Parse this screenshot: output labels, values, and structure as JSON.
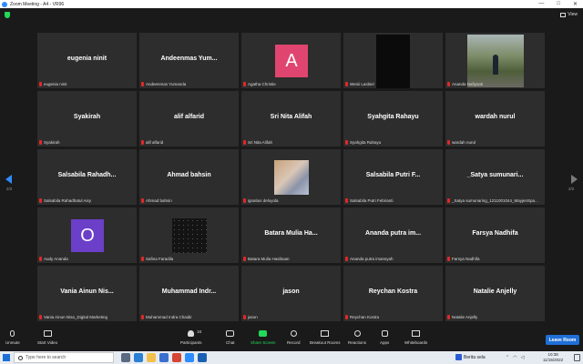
{
  "window": {
    "title": "Zoom Meeting - A4 - VR96",
    "controls": [
      "—",
      "□",
      "✕"
    ]
  },
  "view": {
    "label": "View"
  },
  "participants": [
    {
      "name": "eugenia ninit",
      "footer": "eugenia ninit",
      "media": "none"
    },
    {
      "name": "Andeenmas  Yum...",
      "footer": "Andeenmas Yumanda",
      "media": "none"
    },
    {
      "name": "",
      "footer": "Agatha Christie",
      "media": "avatar",
      "avatar_letter": "A",
      "avatar_color": "#e0456f"
    },
    {
      "name": "",
      "footer": "Wenii Lasbiel",
      "media": "dark"
    },
    {
      "name": "",
      "footer": "Ananda Nafiysah",
      "media": "photo"
    },
    {
      "name": "Syakirah",
      "footer": "Syakirah",
      "media": "none"
    },
    {
      "name": "alif alfarid",
      "footer": "alif alfarid",
      "media": "none"
    },
    {
      "name": "Sri Nita Alifah",
      "footer": "Sri Nita Alifah",
      "media": "none"
    },
    {
      "name": "Syahgita Rahayu",
      "footer": "Syahgita Rahayu",
      "media": "none"
    },
    {
      "name": "wardah nurul",
      "footer": "wardah nurul",
      "media": "none"
    },
    {
      "name": "Salsabila  Rahadh...",
      "footer": "Salsabila Rahadhatul Aisy",
      "media": "none"
    },
    {
      "name": "Ahmad bahsin",
      "footer": "Ahmad bahsin",
      "media": "none"
    },
    {
      "name": "",
      "footer": "ignatius deloyola",
      "media": "face"
    },
    {
      "name": "Salsabila  Putri  F...",
      "footer": "Salsabila Putri Febrianti",
      "media": "none"
    },
    {
      "name": "_Satya  sumunari...",
      "footer": "_Satya sumunaring_1211001044_MayjenSpa...",
      "media": "none"
    },
    {
      "name": "",
      "footer": "Audy Ananda",
      "media": "avatar",
      "avatar_letter": "O",
      "avatar_color": "#6c3fc9"
    },
    {
      "name": "",
      "footer": "Safina Faradila",
      "media": "stars"
    },
    {
      "name": "Batara  Mulia  Ha...",
      "footer": "Batara Mulia Hasibuan",
      "media": "none"
    },
    {
      "name": "Ananda  putra  im...",
      "footer": "Ananda putra imansyah",
      "media": "none"
    },
    {
      "name": "Farsya Nadhifa",
      "footer": "Farsya Nadhifa",
      "media": "none"
    },
    {
      "name": "Vania  Ainun  Nis...",
      "footer": "Vania Ainun Nisa_Digital Marketing",
      "media": "none"
    },
    {
      "name": "Muhammad  Indr...",
      "footer": "Muhammad Indra Chaidir",
      "media": "none"
    },
    {
      "name": "jason",
      "footer": "jason",
      "media": "none"
    },
    {
      "name": "Reychan Kostra",
      "footer": "Reychan Kostra",
      "media": "none"
    },
    {
      "name": "Natalie Anjelly",
      "footer": "Natalie Anjelly",
      "media": "none"
    }
  ],
  "pagination": {
    "left": "2/2",
    "right": "2/2"
  },
  "toolbar": {
    "unmute": "Unmute",
    "start_video": "Start Video",
    "participants": "Participants",
    "participant_count": "34",
    "chat": "Chat",
    "share_screen": "Share Screen",
    "record": "Record",
    "breakout": "Breakout Rooms",
    "reactions": "Reactions",
    "apps": "Apps",
    "whiteboards": "Whiteboards",
    "leave": "Leave Room"
  },
  "taskbar": {
    "search_placeholder": "Type here to search",
    "weather": "Berita sela",
    "time": "10:38",
    "date": "11/15/2022"
  },
  "colors": {
    "accent": "#2d8cff",
    "share_green": "#23d959",
    "leave_blue": "#1f6fd6",
    "tile_bg": "#2d2d2d"
  }
}
